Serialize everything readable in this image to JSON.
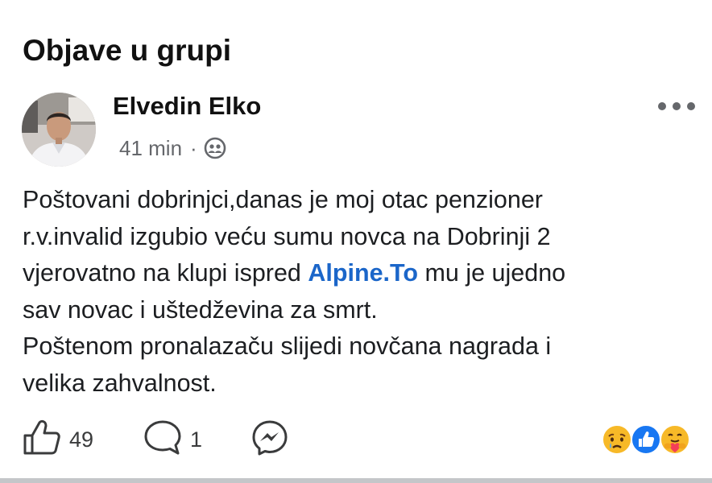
{
  "group_section": {
    "title": "Objave u grupi"
  },
  "post": {
    "author": "Elvedin Elko",
    "time": "41 min",
    "separator": "·",
    "privacy_icon": "group-privacy-icon",
    "more_icon": "more-horizontal-icon",
    "body": {
      "line1": "Poštovani dobrinjci,danas je moj otac penzioner",
      "line2": "r.v.invalid izgubio veću sumu novca na Dobrinji 2",
      "line3_before": "vjerovatno na klupi ispred ",
      "line3_mention": "Alpine.To",
      "line3_after": " mu je ujedno",
      "line4": "sav novac i uštedževina za smrt.",
      "line5": "Poštenom pronalazaču slijedi novčana nagrada i",
      "line6": "velika zahvalnost."
    },
    "actions": {
      "like_count": "49",
      "comment_count": "1",
      "like_icon": "thumbs-up-icon",
      "comment_icon": "comment-bubble-icon",
      "share_icon": "messenger-icon"
    },
    "reactions": [
      "sad-emoji-icon",
      "like-reaction-icon",
      "care-emoji-icon"
    ]
  },
  "colors": {
    "mention": "#1b66c9",
    "meta_text": "#65676b",
    "like_reaction": "#1877f2",
    "emoji_yellow": "#f7b928",
    "divider": "#c4c6c9"
  }
}
